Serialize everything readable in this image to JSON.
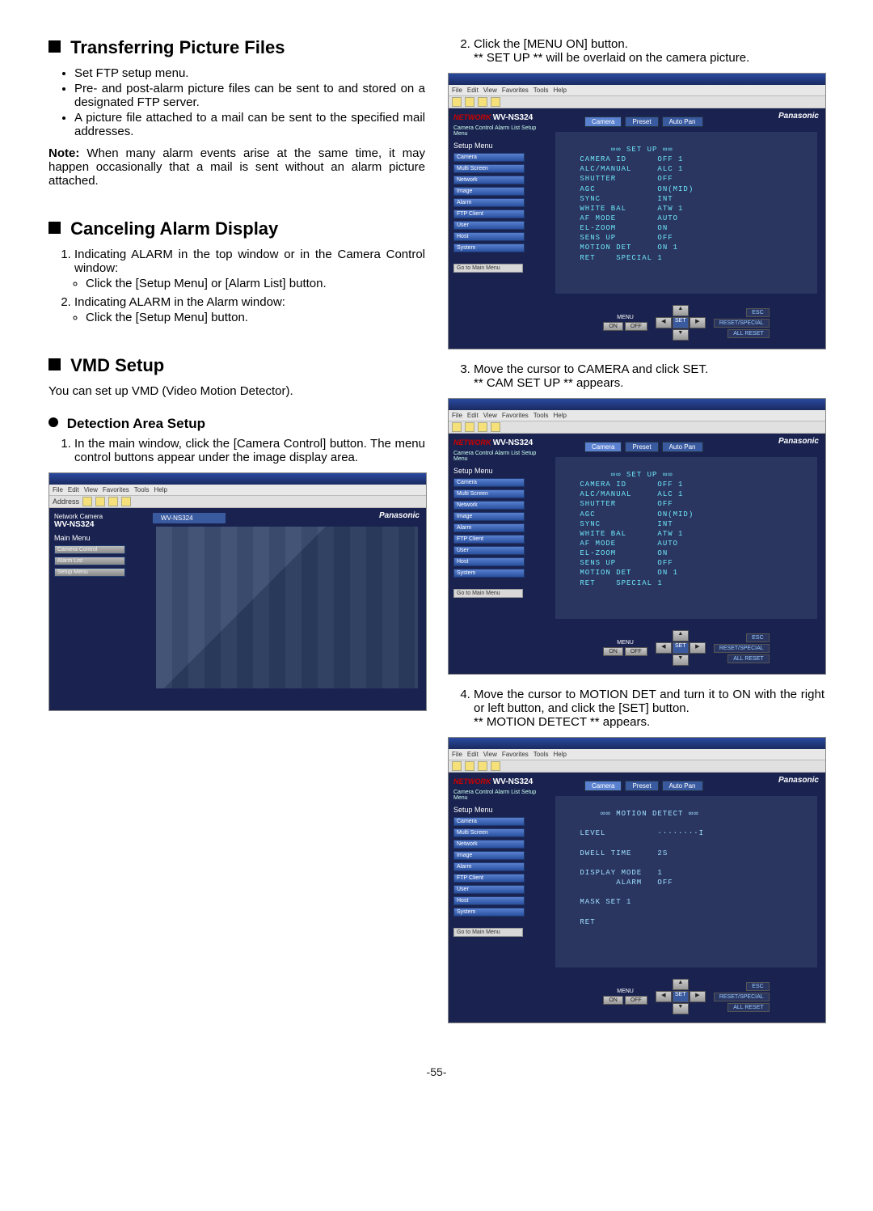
{
  "pagenum": "-55-",
  "left": {
    "sec1": {
      "title": "Transferring Picture Files",
      "b1": "Set FTP setup menu.",
      "b2": "Pre- and post-alarm picture files can be sent to and stored on a designated FTP server.",
      "b3": "A picture file attached to a mail can be sent to the specified mail addresses.",
      "note_label": "Note:",
      "note_body": " When many alarm events arise at the same time, it may happen occasionally that a mail is sent without an alarm picture attached."
    },
    "sec2": {
      "title": "Canceling Alarm Display",
      "n1": "Indicating ALARM in the top window or in the Camera Control window:",
      "n1b1": "Click the [Setup Menu] or [Alarm List] button.",
      "n2": "Indicating ALARM in the Alarm window:",
      "n2b1": "Click the [Setup Menu] button."
    },
    "sec3": {
      "title": "VMD Setup",
      "intro": "You can set up VMD (Video Motion Detector).",
      "sub": "Detection Area Setup",
      "n1": "In the main window, click the [Camera Control] button. The menu control buttons appear under the image display area."
    }
  },
  "right": {
    "n2a": "Click the [MENU ON] button.",
    "n2b": "** SET UP ** will be overlaid on the camera picture.",
    "n3a": "Move the cursor to CAMERA and click SET.",
    "n3b": "** CAM SET UP ** appears.",
    "n4a": "Move the cursor to MOTION DET and turn it to ON with the right or left button, and click the [SET] button.",
    "n4b": "** MOTION DETECT ** appears."
  },
  "ui": {
    "menubar": [
      "File",
      "Edit",
      "View",
      "Favorites",
      "Tools",
      "Help"
    ],
    "address_label": "Address",
    "brand_net": "NETWORK",
    "brand_cam": "Camera",
    "model": "WV-NS324",
    "side_tabs": "Camera Control  Alarm List  Setup Menu",
    "panasonic": "Panasonic",
    "main_menu_title": "Main Menu",
    "main_menu_items": [
      "Camera Control",
      "Alarm List",
      "Setup Menu"
    ],
    "setup_menu_title": "Setup Menu",
    "setup_menu_items": [
      "Camera",
      "Multi Screen",
      "Network",
      "Image",
      "Alarm",
      "FTP Client",
      "User",
      "Host",
      "System"
    ],
    "go_main": "Go to Main Menu",
    "cam_tabs": [
      "Camera",
      "Preset",
      "Auto Pan"
    ],
    "setup_overlay": "       ∞∞ SET UP ∞∞\n CAMERA ID      OFF 1\n ALC/MANUAL     ALC 1\n SHUTTER        OFF\n AGC            ON(MID)\n SYNC           INT\n WHITE BAL      ATW 1\n AF MODE        AUTO\n EL-ZOOM        ON\n SENS UP        OFF\n MOTION DET     ON 1\n RET    SPECIAL 1",
    "motion_overlay": "     ∞∞ MOTION DETECT ∞∞\n\n LEVEL          ········I\n\n DWELL TIME     2S\n\n DISPLAY MODE   1\n        ALARM   OFF\n\n MASK SET 1\n\n RET",
    "ctrl": {
      "menu": "MENU",
      "on": "ON",
      "off": "OFF",
      "set": "SET",
      "up": "▲",
      "down": "▼",
      "left": "◀",
      "right": "▶",
      "esc": "ESC",
      "reset_special": "RESET/SPECIAL",
      "all_reset": "ALL RESET"
    },
    "net_cam_lines": [
      "Network Camera",
      "WV-NS324"
    ]
  }
}
